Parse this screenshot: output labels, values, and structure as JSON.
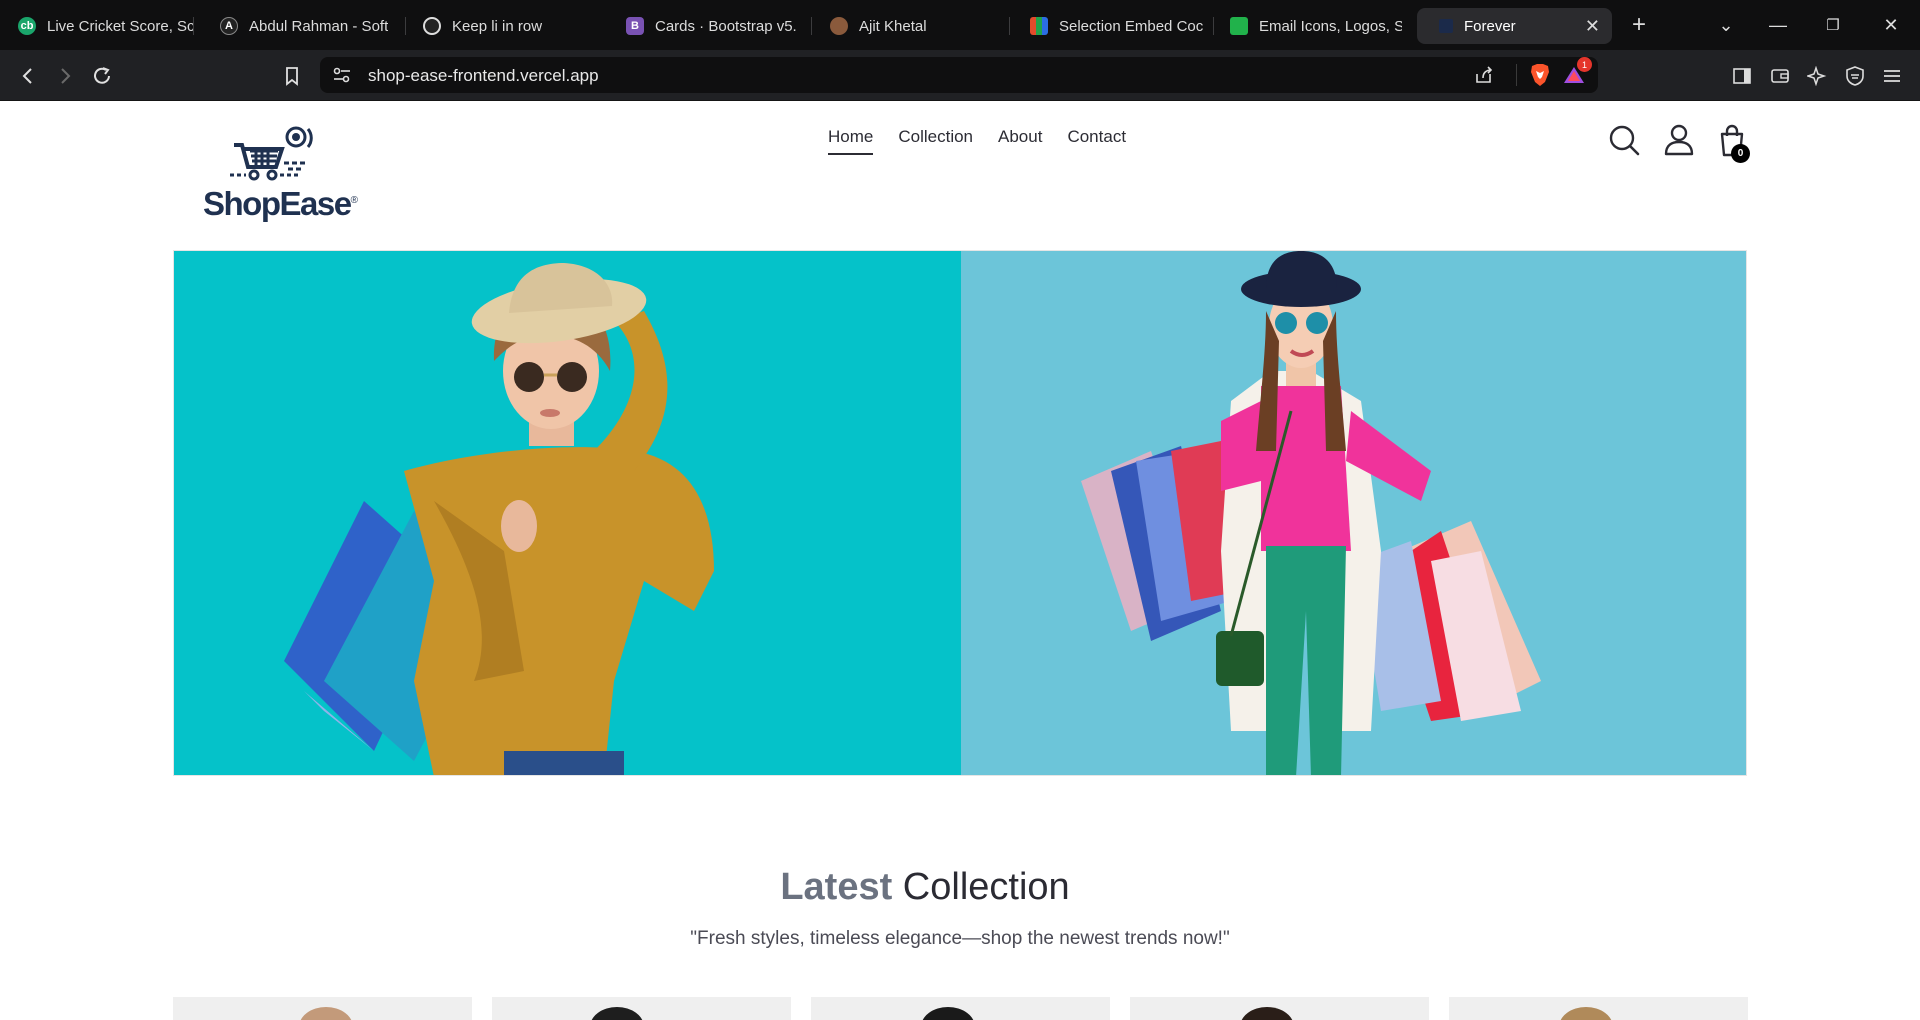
{
  "browser": {
    "tabs": [
      {
        "title": "Live Cricket Score, Sc",
        "icon": "cricbuzz-icon",
        "color": "#1aa56b"
      },
      {
        "title": "Abdul Rahman - Soft",
        "icon": "portfolio-icon",
        "color": "#222222"
      },
      {
        "title": "Keep li in row",
        "icon": "chatgpt-icon",
        "color": "#222222"
      },
      {
        "title": "Cards · Bootstrap v5.",
        "icon": "bootstrap-icon",
        "color": "#7952b3"
      },
      {
        "title": "Ajit Khetal",
        "icon": "avatar-icon",
        "color": "#8a5a3c"
      },
      {
        "title": "Selection Embed Coc",
        "icon": "zoho-icon",
        "color": "#e34b2b"
      },
      {
        "title": "Email Icons, Logos, S",
        "icon": "iconscout-icon",
        "color": "#21b24b"
      },
      {
        "title": "Forever",
        "icon": "page-icon",
        "color": "#1b2a4a"
      }
    ],
    "url": "shop-ease-frontend.vercel.app",
    "rewards_badge": "1"
  },
  "site": {
    "logo_text": "ShopEase",
    "logo_mark": "®",
    "nav": [
      {
        "label": "Home",
        "active": true
      },
      {
        "label": "Collection",
        "active": false
      },
      {
        "label": "About",
        "active": false
      },
      {
        "label": "Contact",
        "active": false
      }
    ],
    "cart_count": "0"
  },
  "latest": {
    "title_light": "Latest",
    "title_dark": "Collection",
    "subtitle": "\"Fresh styles, timeless elegance—shop the newest trends now!\""
  },
  "colors": {
    "hero_left": "#05c2c9",
    "hero_right": "#6cc5d9",
    "brand_navy": "#1f3150"
  }
}
